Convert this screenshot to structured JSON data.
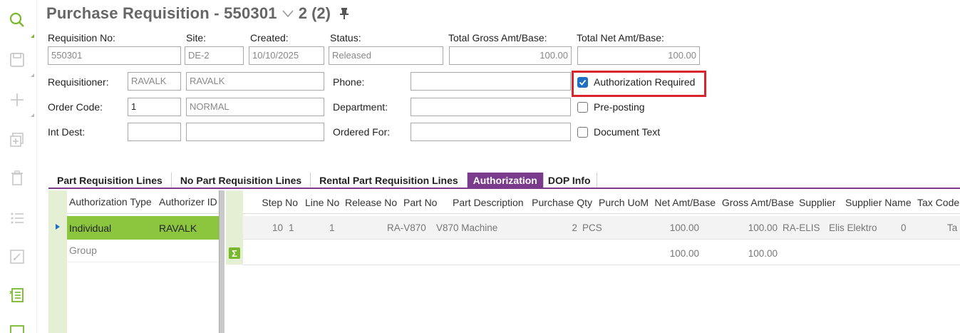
{
  "toolbar": {
    "icons": [
      "search-icon",
      "save-icon",
      "add-icon",
      "duplicate-icon",
      "delete-icon",
      "list-icon",
      "open-icon",
      "details-icon",
      "export-icon"
    ]
  },
  "header": {
    "title": "Purchase Requisition - 550301",
    "record_pos": "2 (2)"
  },
  "fields": {
    "requisition_no": {
      "label": "Requisition No:",
      "value": "550301"
    },
    "site": {
      "label": "Site:",
      "value": "DE-2"
    },
    "created": {
      "label": "Created:",
      "value": "10/10/2025"
    },
    "status": {
      "label": "Status:",
      "value": "Released"
    },
    "total_gross": {
      "label": "Total Gross Amt/Base:",
      "value": "100.00"
    },
    "total_net": {
      "label": "Total Net Amt/Base:",
      "value": "100.00"
    },
    "requisitioner": {
      "label": "Requisitioner:",
      "code": "RAVALK",
      "name": "RAVALK"
    },
    "order_code": {
      "label": "Order Code:",
      "code": "1",
      "name": "NORMAL"
    },
    "int_dest": {
      "label": "Int Dest:",
      "code": "",
      "name": ""
    },
    "phone": {
      "label": "Phone:",
      "value": ""
    },
    "department": {
      "label": "Department:",
      "value": ""
    },
    "ordered_for": {
      "label": "Ordered For:",
      "value": ""
    }
  },
  "checkboxes": {
    "authorization_required": {
      "label": "Authorization Required",
      "checked": true
    },
    "pre_posting": {
      "label": "Pre-posting",
      "checked": false
    },
    "document_text": {
      "label": "Document Text",
      "checked": false
    }
  },
  "tabs": [
    {
      "label": "Part Requisition Lines"
    },
    {
      "label": "No Part Requisition Lines"
    },
    {
      "label": "Rental Part Requisition Lines"
    },
    {
      "label": "Authorization",
      "active": true
    },
    {
      "label": "DOP Info"
    }
  ],
  "auth_grid": {
    "columns": [
      "Authorization Type",
      "Authorizer ID"
    ],
    "rows": [
      {
        "type": "Individual",
        "id": "RAVALK",
        "selected": true
      },
      {
        "type": "Group",
        "id": ""
      }
    ]
  },
  "lines_grid": {
    "columns": [
      "Step No",
      "Line No",
      "Release No",
      "Part No",
      "Part Description",
      "Purchase Qty",
      "Purch UoM",
      "Net Amt/Base",
      "Gross Amt/Base",
      "Supplier",
      "Supplier Name",
      "Tax Code",
      "Ta"
    ],
    "row": [
      "10",
      "1",
      "1",
      "RA-V870",
      "V870 Machine",
      "2",
      "PCS",
      "100.00",
      "100.00",
      "RA-ELIS",
      "Elis Elektro",
      "0",
      "Ta"
    ],
    "sum": {
      "net": "100.00",
      "gross": "100.00"
    }
  },
  "colors": {
    "accent": "#8cc63f",
    "tab_active": "#7b3b8c",
    "highlight": "#d9252c",
    "checkbox": "#1f6fc5"
  }
}
